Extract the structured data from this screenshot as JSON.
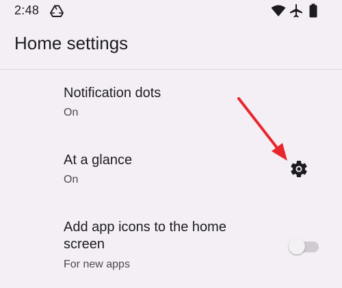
{
  "status_bar": {
    "time": "2:48",
    "icons": [
      "drive-icon",
      "wifi-icon",
      "airplane-mode-icon",
      "battery-icon"
    ]
  },
  "header": {
    "title": "Home settings"
  },
  "preferences": [
    {
      "title": "Notification dots",
      "summary": "On"
    },
    {
      "title": "At a glance",
      "summary": "On",
      "action_icon": "gear-icon"
    },
    {
      "title": "Add app icons to the home screen",
      "summary": "For new apps",
      "toggle_on": false
    }
  ],
  "colors": {
    "background": "#f4eff4",
    "text_primary": "#1d1b20",
    "text_secondary": "#4b474f",
    "annotation_arrow": "#e8262c",
    "toggle_track_off": "#cfcbd0"
  }
}
